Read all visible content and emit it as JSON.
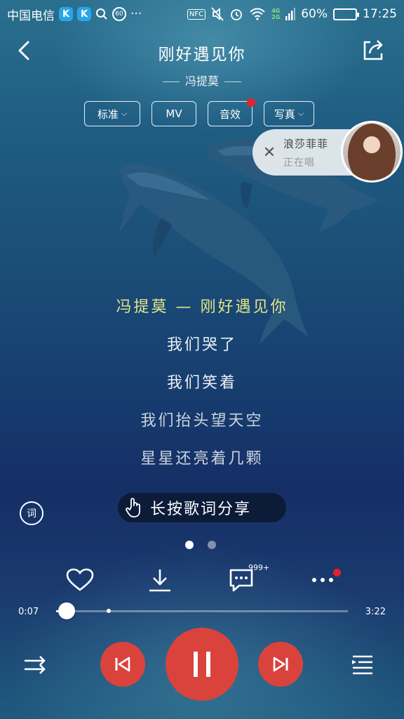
{
  "status_bar": {
    "carrier": "中国电信",
    "badge_k1": "K",
    "badge_k2": "K",
    "badge_60": "60",
    "more": "···",
    "nfc": "NFC",
    "net_4g": "4G",
    "net_2g": "2G",
    "battery": "60%",
    "battery_fraction": 0.6,
    "time": "17:25"
  },
  "header": {
    "title": "刚好遇见你",
    "artist": "冯提莫"
  },
  "options": {
    "quality": "标准",
    "mv": "MV",
    "effects": "音效",
    "photo": "写真"
  },
  "live": {
    "name": "浪莎菲菲",
    "status": "正在唱"
  },
  "lyrics": [
    "冯提莫 — 刚好遇见你",
    "我们哭了",
    "我们笑着",
    "我们抬头望天空",
    "星星还亮着几颗"
  ],
  "lyric_button": "词",
  "share_hint": "长按歌词分享",
  "actions": {
    "comment_count": "999+"
  },
  "playback": {
    "current_time": "0:07",
    "total_time": "3:22",
    "progress_fraction": 0.036,
    "buffered_fraction": 0.18
  },
  "colors": {
    "accent_red": "#d9433c",
    "current_lyric": "#e3e58a",
    "notification_dot": "#e8202a"
  }
}
